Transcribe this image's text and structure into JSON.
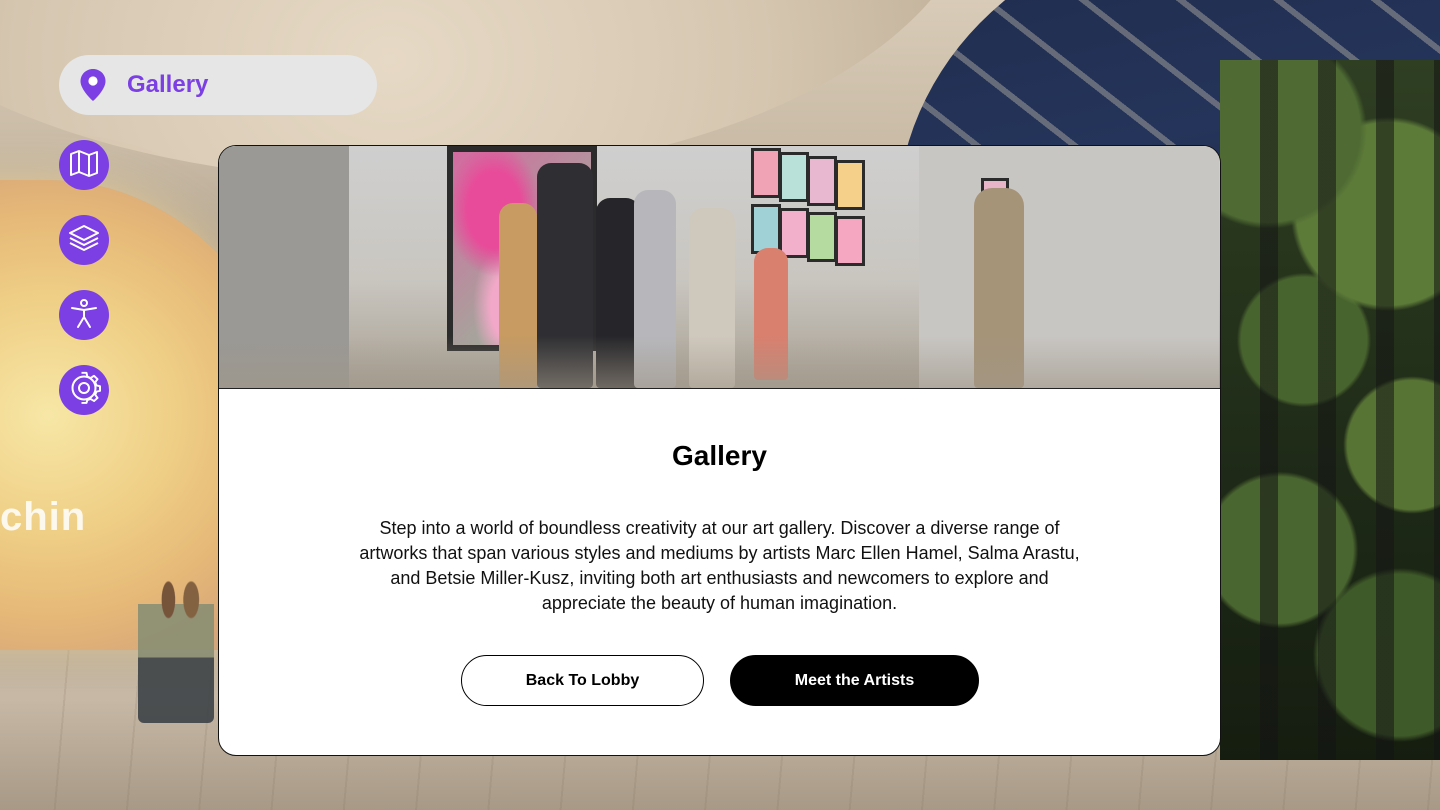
{
  "location": {
    "label": "Gallery",
    "icon": "map-pin-icon"
  },
  "nav": [
    {
      "name": "map",
      "icon": "map-icon"
    },
    {
      "name": "layers",
      "icon": "layers-icon"
    },
    {
      "name": "accessibility",
      "icon": "accessibility-icon"
    },
    {
      "name": "settings",
      "icon": "gear-icon"
    }
  ],
  "background": {
    "screen_text": "chin"
  },
  "card": {
    "title": "Gallery",
    "description": "Step into a world of boundless creativity at our art gallery. Discover a diverse range of artworks that span various styles and mediums by artists Marc Ellen Hamel, Salma Arastu, and Betsie Miller-Kusz, inviting both art enthusiasts and newcomers to explore and appreciate the beauty of human imagination.",
    "secondary_button": "Back To Lobby",
    "primary_button": "Meet the Artists"
  },
  "colors": {
    "accent": "#7b3fe4",
    "pill_bg": "#e6e6e6",
    "primary_btn": "#000000"
  }
}
